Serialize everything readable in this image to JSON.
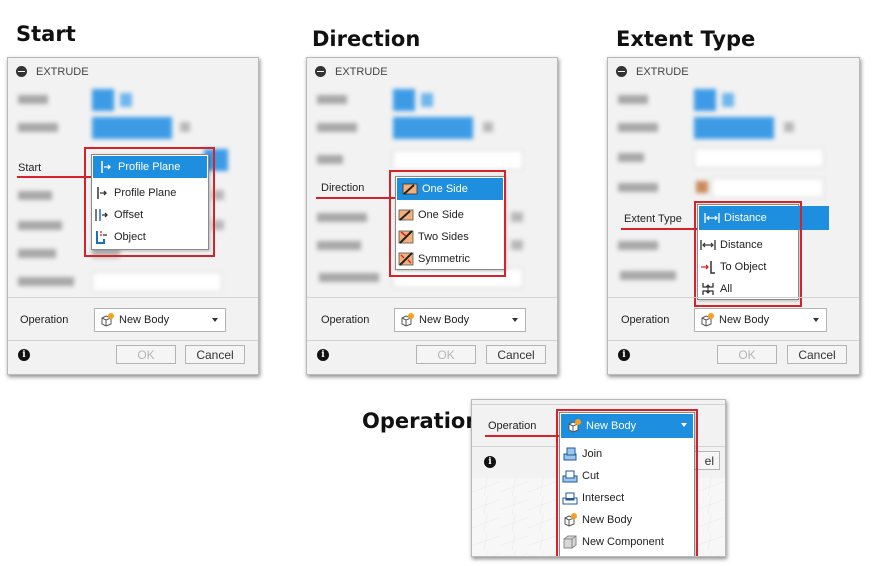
{
  "titles": {
    "start": "Start",
    "direction": "Direction",
    "extent_type": "Extent Type",
    "operation": "Operation"
  },
  "dialog": {
    "header": "EXTRUDE",
    "operation_label": "Operation",
    "operation_value": "New Body",
    "ok_label": "OK",
    "cancel_label": "Cancel",
    "info_glyph": "i"
  },
  "start_panel": {
    "row_label": "Start",
    "selected": "Profile Plane",
    "options": [
      {
        "label": "Profile Plane",
        "icon": "profile-plane-icon"
      },
      {
        "label": "Offset",
        "icon": "offset-icon"
      },
      {
        "label": "Object",
        "icon": "object-icon"
      }
    ]
  },
  "direction_panel": {
    "row_label": "Direction",
    "selected": "One Side",
    "options": [
      {
        "label": "One Side",
        "icon": "one-side-icon"
      },
      {
        "label": "Two Sides",
        "icon": "two-sides-icon"
      },
      {
        "label": "Symmetric",
        "icon": "symmetric-icon"
      }
    ]
  },
  "extent_panel": {
    "row_label": "Extent Type",
    "selected": "Distance",
    "options": [
      {
        "label": "Distance",
        "icon": "distance-icon"
      },
      {
        "label": "To Object",
        "icon": "to-object-icon"
      },
      {
        "label": "All",
        "icon": "all-icon"
      }
    ]
  },
  "operation_panel": {
    "row_label": "Operation",
    "selected": "New Body",
    "options": [
      {
        "label": "Join",
        "icon": "join-icon"
      },
      {
        "label": "Cut",
        "icon": "cut-icon"
      },
      {
        "label": "Intersect",
        "icon": "intersect-icon"
      },
      {
        "label": "New Body",
        "icon": "new-body-icon"
      },
      {
        "label": "New Component",
        "icon": "new-component-icon"
      }
    ]
  },
  "colors": {
    "highlight_red": "#d6232a",
    "selection_blue": "#1e8fde",
    "dialog_bg": "#f2f2f2"
  }
}
